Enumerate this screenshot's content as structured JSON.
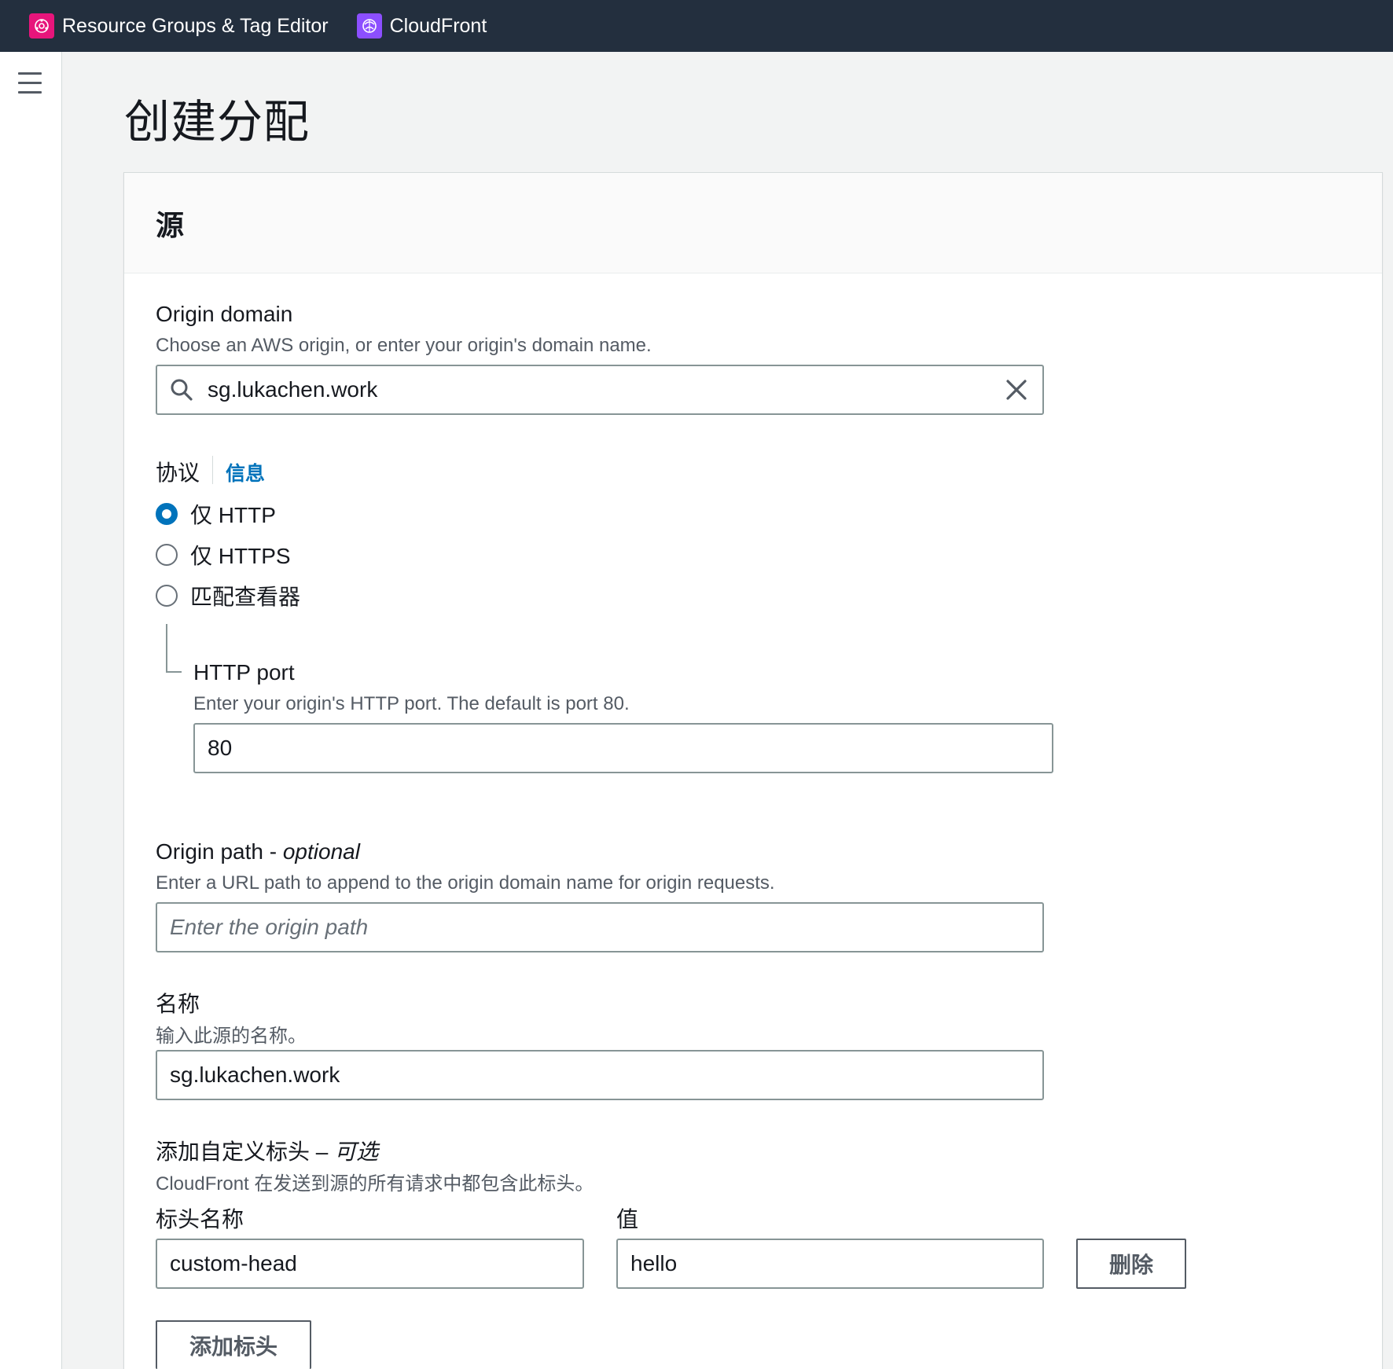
{
  "topbar": {
    "services": [
      {
        "label": "Resource Groups & Tag Editor",
        "icon": "resource-groups-icon",
        "color": "#e7157b"
      },
      {
        "label": "CloudFront",
        "icon": "cloudfront-icon",
        "color": "#8c4fff"
      }
    ],
    "background": "#232f3e"
  },
  "page": {
    "title": "创建分配"
  },
  "panel": {
    "title": "源",
    "origin_domain": {
      "label": "Origin domain",
      "description": "Choose an AWS origin, or enter your origin's domain name.",
      "value": "sg.lukachen.work"
    },
    "protocol": {
      "label": "协议",
      "info_link": "信息",
      "options": [
        {
          "label": "仅 HTTP",
          "checked": true
        },
        {
          "label": "仅 HTTPS",
          "checked": false
        },
        {
          "label": "匹配查看器",
          "checked": false
        }
      ]
    },
    "http_port": {
      "label": "HTTP port",
      "description": "Enter your origin's HTTP port. The default is port 80.",
      "value": "80"
    },
    "origin_path": {
      "label": "Origin path - ",
      "label_optional": "optional",
      "description": "Enter a URL path to append to the origin domain name for origin requests.",
      "placeholder": "Enter the origin path"
    },
    "name": {
      "label": "名称",
      "description": "输入此源的名称。",
      "value": "sg.lukachen.work"
    },
    "custom_headers": {
      "label": "添加自定义标头 – ",
      "label_optional": "可选",
      "description": "CloudFront 在发送到源的所有请求中都包含此标头。",
      "header_name_label": "标头名称",
      "value_label": "值",
      "header_name": "custom-head",
      "header_value": "hello",
      "delete_button": "删除",
      "add_button": "添加标头"
    }
  },
  "colors": {
    "accent": "#0073bb"
  }
}
